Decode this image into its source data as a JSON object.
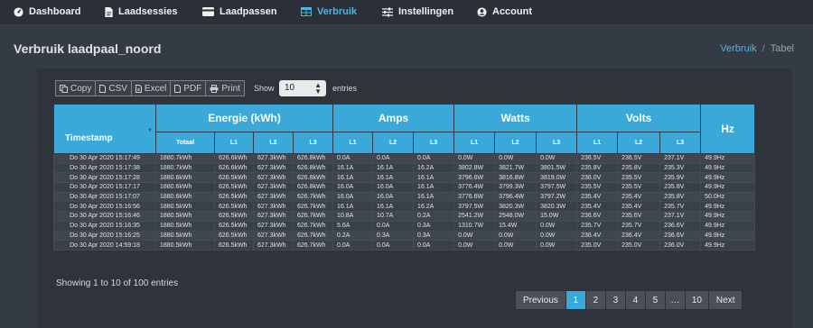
{
  "nav": {
    "items": [
      {
        "label": "Dashboard",
        "icon": "dashboard-icon"
      },
      {
        "label": "Laadsessies",
        "icon": "file-icon"
      },
      {
        "label": "Laadpassen",
        "icon": "card-icon"
      },
      {
        "label": "Verbruik",
        "icon": "table-icon",
        "active": true
      },
      {
        "label": "Instellingen",
        "icon": "sliders-icon"
      },
      {
        "label": "Account",
        "icon": "user-icon"
      }
    ],
    "accent": "#4fb3e0"
  },
  "page": {
    "title": "Verbruik laadpaal_noord",
    "breadcrumb": [
      "Verbruik",
      "Tabel"
    ]
  },
  "toolbar": {
    "copy": "Copy",
    "csv": "CSV",
    "excel": "Excel",
    "pdf": "PDF",
    "print": "Print",
    "show_label": "Show",
    "entries_label": "entries",
    "page_size": "10"
  },
  "table": {
    "group_headers": {
      "timestamp": "Timestamp",
      "energy": "Energie (kWh)",
      "amps": "Amps",
      "watts": "Watts",
      "volts": "Volts",
      "hz": "Hz"
    },
    "sub_headers": {
      "totaal": "Totaal",
      "l1": "L1",
      "l2": "L2",
      "l3": "L3"
    },
    "rows": [
      [
        "Do 30 Apr 2020 15:17:49",
        "1880.7kWh",
        "626.6kWh",
        "627.3kWh",
        "626.8kWh",
        "0.0A",
        "0.0A",
        "0.0A",
        "0.0W",
        "0.0W",
        "0.0W",
        "236.5V",
        "236.5V",
        "237.1V",
        "49.9Hz"
      ],
      [
        "Do 30 Apr 2020 15:17:38",
        "1880.7kWh",
        "626.6kWh",
        "627.3kWh",
        "626.8kWh",
        "16.1A",
        "16.1A",
        "16.2A",
        "3802.8W",
        "3821.7W",
        "3801.5W",
        "235.8V",
        "235.8V",
        "235.3V",
        "49.9Hz"
      ],
      [
        "Do 30 Apr 2020 15:17:28",
        "1880.6kWh",
        "626.5kWh",
        "627.3kWh",
        "626.8kWh",
        "16.1A",
        "16.1A",
        "16.1A",
        "3796.6W",
        "3816.8W",
        "3819.0W",
        "236.0V",
        "235.5V",
        "235.9V",
        "49.9Hz"
      ],
      [
        "Do 30 Apr 2020 15:17:17",
        "1880.6kWh",
        "626.5kWh",
        "627.3kWh",
        "626.8kWh",
        "16.0A",
        "16.0A",
        "16.1A",
        "3776.4W",
        "3799.3W",
        "3797.5W",
        "235.5V",
        "235.5V",
        "235.8V",
        "49.9Hz"
      ],
      [
        "Do 30 Apr 2020 15:17:07",
        "1880.6kWh",
        "626.5kWh",
        "627.3kWh",
        "626.7kWh",
        "16.0A",
        "16.0A",
        "16.1A",
        "3776.6W",
        "3796.4W",
        "3797.2W",
        "235.4V",
        "235.4V",
        "235.8V",
        "50.0Hz"
      ],
      [
        "Do 30 Apr 2020 15:16:56",
        "1880.5kWh",
        "626.5kWh",
        "627.3kWh",
        "626.7kWh",
        "16.1A",
        "16.1A",
        "16.2A",
        "3797.5W",
        "3820.3W",
        "3820.3W",
        "235.4V",
        "235.4V",
        "235.7V",
        "49.9Hz"
      ],
      [
        "Do 30 Apr 2020 15:16:46",
        "1880.5kWh",
        "626.5kWh",
        "627.3kWh",
        "626.7kWh",
        "10.8A",
        "10.7A",
        "0.2A",
        "2541.2W",
        "2548.0W",
        "15.0W",
        "236.6V",
        "235.6V",
        "237.1V",
        "49.9Hz"
      ],
      [
        "Do 30 Apr 2020 15:16:35",
        "1880.5kWh",
        "626.5kWh",
        "627.3kWh",
        "626.7kWh",
        "5.6A",
        "0.0A",
        "0.3A",
        "1310.7W",
        "15.4W",
        "0.0W",
        "235.7V",
        "235.7V",
        "236.6V",
        "49.9Hz"
      ],
      [
        "Do 30 Apr 2020 15:16:25",
        "1880.5kWh",
        "626.5kWh",
        "627.3kWh",
        "626.7kWh",
        "0.2A",
        "0.3A",
        "0.3A",
        "0.0W",
        "0.0W",
        "0.0W",
        "236.4V",
        "236.4V",
        "236.6V",
        "49.9Hz"
      ],
      [
        "Do 30 Apr 2020 14:59:18",
        "1880.5kWh",
        "626.5kWh",
        "627.3kWh",
        "626.7kWh",
        "0.0A",
        "0.0A",
        "0.0A",
        "0.0W",
        "0.0W",
        "0.0W",
        "235.0V",
        "235.0V",
        "236.0V",
        "49.9Hz"
      ]
    ]
  },
  "footer": {
    "info": "Showing 1 to 10 of 100 entries"
  },
  "pagination": {
    "previous": "Previous",
    "next": "Next",
    "pages": [
      "1",
      "2",
      "3",
      "4",
      "5",
      "…",
      "10"
    ],
    "active": "1"
  }
}
